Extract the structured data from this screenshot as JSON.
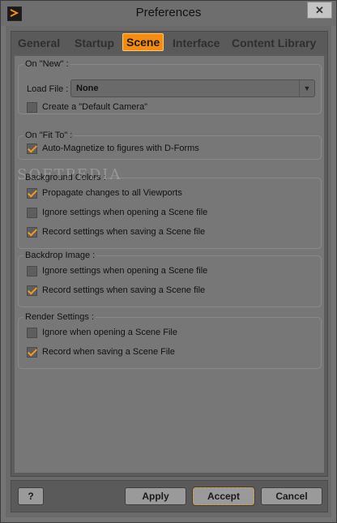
{
  "window": {
    "title": "Preferences",
    "close_symbol": "✕"
  },
  "tabs": [
    {
      "label": "General"
    },
    {
      "label": "Startup"
    },
    {
      "label": "Scene",
      "active": true
    },
    {
      "label": "Interface"
    },
    {
      "label": "Content Library"
    }
  ],
  "groups": {
    "on_new": {
      "title": "On \"New\" :",
      "load_file_label": "Load File :",
      "load_file_value": "None",
      "default_camera": {
        "label": "Create a \"Default Camera\"",
        "checked": false
      }
    },
    "on_fit_to": {
      "title": "On \"Fit To\" :",
      "auto_magnetize": {
        "label": "Auto-Magnetize to figures with D-Forms",
        "checked": true
      }
    },
    "background_colors": {
      "title": "Background Colors :",
      "propagate": {
        "label": "Propagate changes to all Viewports",
        "checked": true
      },
      "ignore_open": {
        "label": "Ignore settings when opening a Scene file",
        "checked": false
      },
      "record_save": {
        "label": "Record settings when saving a Scene file",
        "checked": true
      }
    },
    "backdrop_image": {
      "title": "Backdrop Image :",
      "ignore_open": {
        "label": "Ignore settings when opening a Scene file",
        "checked": false
      },
      "record_save": {
        "label": "Record settings when saving a Scene file",
        "checked": true
      }
    },
    "render_settings": {
      "title": "Render Settings :",
      "ignore_open": {
        "label": "Ignore when opening a Scene File",
        "checked": false
      },
      "record_save": {
        "label": "Record when saving a Scene File",
        "checked": true
      }
    }
  },
  "footer": {
    "help_label": "?",
    "apply_label": "Apply",
    "accept_label": "Accept",
    "cancel_label": "Cancel"
  },
  "watermark": "SOFTPEDIA",
  "colors": {
    "accent": "#f58c0f",
    "check": "#f59a20"
  }
}
